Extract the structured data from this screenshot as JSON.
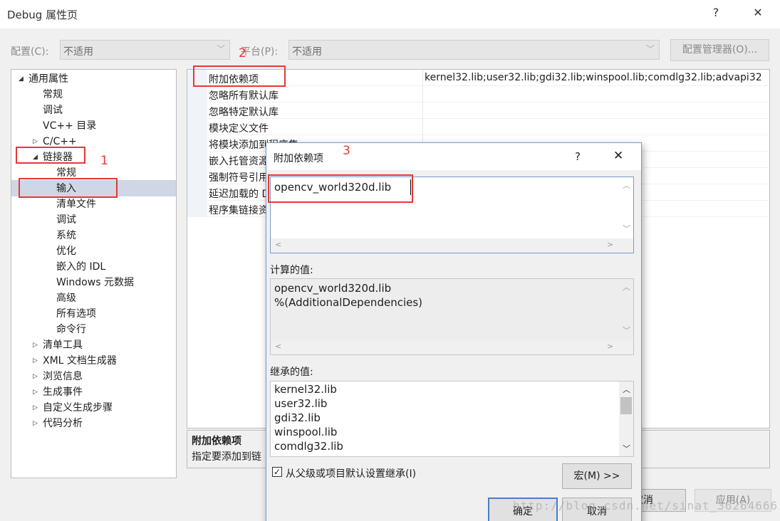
{
  "window": {
    "title": "Debug 属性页",
    "help_icon": "?",
    "close_icon": "✕"
  },
  "toolbar": {
    "config_label": "配置(C):",
    "config_value": "不适用",
    "platform_label": "平台(P):",
    "platform_value": "不适用",
    "config_manager_button": "配置管理器(O)..."
  },
  "tree": {
    "items": [
      {
        "label": "通用属性",
        "state": "expanded"
      },
      {
        "label": "常规"
      },
      {
        "label": "调试"
      },
      {
        "label": "VC++ 目录"
      },
      {
        "label": "C/C++",
        "state": "collapsed"
      },
      {
        "label": "链接器",
        "state": "expanded"
      },
      {
        "label": "常规"
      },
      {
        "label": "输入",
        "selected": true
      },
      {
        "label": "清单文件"
      },
      {
        "label": "调试"
      },
      {
        "label": "系统"
      },
      {
        "label": "优化"
      },
      {
        "label": "嵌入的 IDL"
      },
      {
        "label": "Windows 元数据"
      },
      {
        "label": "高级"
      },
      {
        "label": "所有选项"
      },
      {
        "label": "命令行"
      },
      {
        "label": "清单工具",
        "state": "collapsed"
      },
      {
        "label": "XML 文档生成器",
        "state": "collapsed"
      },
      {
        "label": "浏览信息",
        "state": "collapsed"
      },
      {
        "label": "生成事件",
        "state": "collapsed"
      },
      {
        "label": "自定义生成步骤",
        "state": "collapsed"
      },
      {
        "label": "代码分析",
        "state": "collapsed"
      }
    ]
  },
  "grid": {
    "rows": [
      {
        "name": "附加依赖项",
        "value": "kernel32.lib;user32.lib;gdi32.lib;winspool.lib;comdlg32.lib;advapi32"
      },
      {
        "name": "忽略所有默认库",
        "value": ""
      },
      {
        "name": "忽略特定默认库",
        "value": ""
      },
      {
        "name": "模块定义文件",
        "value": ""
      },
      {
        "name": "将模块添加到程序集",
        "value": ""
      },
      {
        "name": "嵌入托管资源文件",
        "value": ""
      },
      {
        "name": "强制符号引用",
        "value": ""
      },
      {
        "name": "延迟加载的 DLL",
        "value": ""
      },
      {
        "name": "程序集链接资源",
        "value": ""
      }
    ]
  },
  "description": {
    "title": "附加依赖项",
    "text": "指定要添加到链"
  },
  "bottom_buttons": {
    "cancel": "取消",
    "apply": "应用(A)"
  },
  "annotations": {
    "step1": "1",
    "step2": "2",
    "step3": "3"
  },
  "dialog": {
    "title": "附加依赖项",
    "help_icon": "?",
    "close_icon": "✕",
    "input_value": "opencv_world320d.lib",
    "computed_label": "计算的值:",
    "computed_lines": [
      "opencv_world320d.lib",
      "%(AdditionalDependencies)"
    ],
    "inherited_label": "继承的值:",
    "inherited_lines": [
      "kernel32.lib",
      "user32.lib",
      "gdi32.lib",
      "winspool.lib",
      "comdlg32.lib"
    ],
    "inherit_checkbox_label": "从父级或项目默认设置继承(I)",
    "inherit_checked": true,
    "macro_button": "宏(M) >>",
    "ok_button": "确定",
    "cancel_button": "取消"
  },
  "watermark": "http://blog.csdn.net/sinat_36264666"
}
